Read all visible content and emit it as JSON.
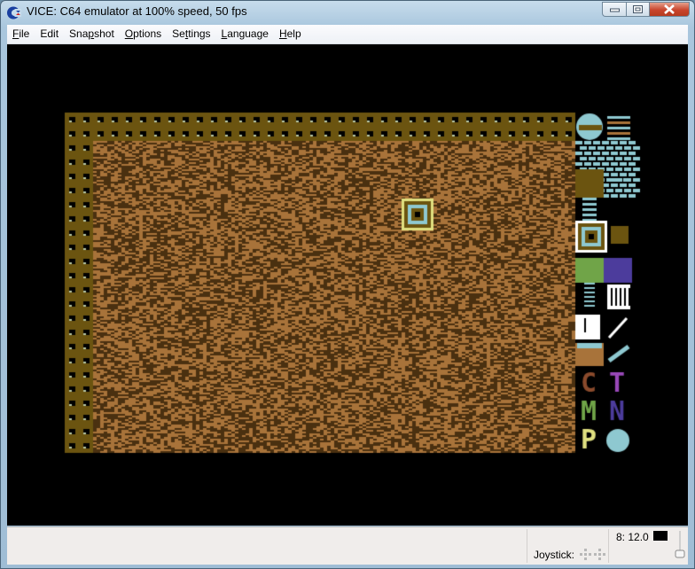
{
  "window": {
    "title": "VICE: C64 emulator at 100% speed, 50 fps",
    "app_icon": "commodore-logo-icon",
    "buttons": [
      "minimize",
      "maximize",
      "close"
    ]
  },
  "menubar": {
    "items": [
      {
        "label": "File",
        "accel": "F",
        "rest": "ile"
      },
      {
        "label": "Edit",
        "accel": "",
        "rest": "Edit"
      },
      {
        "label": "Snapshot",
        "accel": "p",
        "pre": "Sna",
        "rest": "shot"
      },
      {
        "label": "Options",
        "accel": "O",
        "rest": "ptions"
      },
      {
        "label": "Settings",
        "accel": "t",
        "pre": "Se",
        "rest": "tings"
      },
      {
        "label": "Language",
        "accel": "L",
        "rest": "anguage"
      },
      {
        "label": "Help",
        "accel": "H",
        "rest": "elp"
      }
    ]
  },
  "emulator_screen": {
    "description": "C64 game playfield: brown dirt field with studded olive wall border, tile palette on right",
    "colors": {
      "background": "#000000",
      "wall": "#6b5410",
      "stud_dark": "#000000",
      "stud_light": "#b8c8a8",
      "dirt_light": "#a8733a",
      "dirt_dark": "#4a3010",
      "cyan": "#8ec8d0",
      "yellow": "#e0e080",
      "white": "#ffffff",
      "green": "#70a448",
      "purple": "#4c3c9c",
      "violet": "#9848b8",
      "red_brown": "#8a4a2c"
    },
    "palette_tiles": [
      "boulder",
      "striped-ball",
      "brick-wall",
      "brick-wall",
      "steel-wall",
      "arrow-wall",
      "spring",
      "dirt",
      "exit-door-selected",
      "butterfly",
      "amoeba-green",
      "amoeba-purple",
      "spring-column",
      "magic-wall",
      "white-wall",
      "slope",
      "crate",
      "diagonal-steel",
      "letter-C",
      "letter-T",
      "letter-M",
      "letter-N",
      "letter-P",
      "round-rock"
    ],
    "cursor_tile": "exit-door"
  },
  "statusbar": {
    "joystick_label": "Joystick:",
    "drive_label": "8: 12.0"
  }
}
